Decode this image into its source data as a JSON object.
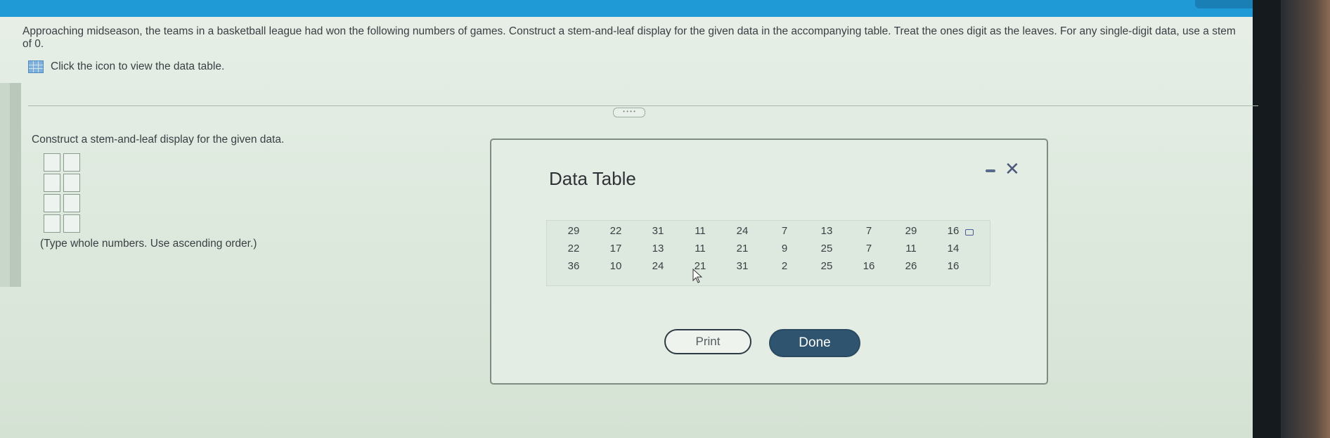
{
  "question": {
    "text": "Approaching midseason, the teams in a basketball league had won the following numbers of games. Construct a stem-and-leaf display for the given data in the accompanying table. Treat the ones digit as the leaves. For any single-digit data, use a stem of 0."
  },
  "data_link": {
    "label": "Click the icon to view the data table.",
    "icon": "table-icon"
  },
  "answer_area": {
    "instruction": "Construct a stem-and-leaf display for the given data.",
    "hint": "(Type whole numbers. Use ascending order.)",
    "rows": 4
  },
  "modal": {
    "title": "Data Table",
    "table": [
      [
        "29",
        "22",
        "31",
        "11",
        "24",
        "7",
        "13",
        "7",
        "29",
        "16"
      ],
      [
        "22",
        "17",
        "13",
        "11",
        "21",
        "9",
        "25",
        "7",
        "11",
        "14"
      ],
      [
        "36",
        "10",
        "24",
        "21",
        "31",
        "2",
        "25",
        "16",
        "26",
        "16"
      ]
    ],
    "print_label": "Print",
    "done_label": "Done"
  },
  "colors": {
    "topbar": "#1f9ad6",
    "done_button": "#2e5470"
  }
}
